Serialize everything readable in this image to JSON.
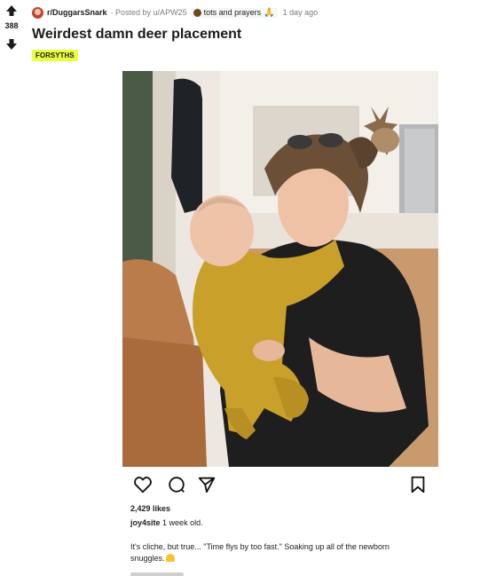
{
  "post": {
    "vote_count": "388",
    "subreddit": "r/DuggarsSnark",
    "posted_by": "· Posted by u/APW25",
    "user_flair": "tots and prayers",
    "time_ago": "1 day ago",
    "title": "Weirdest damn deer placement",
    "flair": "FORSYTHS"
  },
  "instagram": {
    "likes": "2,429 likes",
    "username": "joy4site",
    "age": "1 week old.",
    "caption": "It's cliche, but true... \"Time flys by too fast.\" Soaking up all of the newborn snuggles."
  },
  "icons": [
    "upvote-arrow-icon",
    "downvote-arrow-icon",
    "heart-icon",
    "comment-icon",
    "share-icon",
    "bookmark-icon"
  ],
  "colors": {
    "flair_bg": "#eaff40",
    "baby_outfit": "#c9a12a",
    "shirt": "#1e1e1e"
  }
}
